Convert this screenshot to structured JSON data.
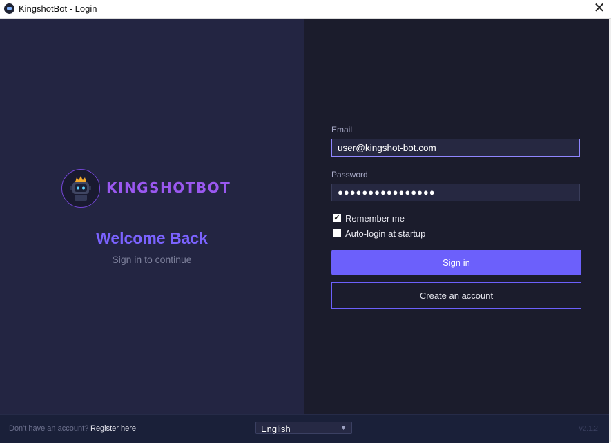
{
  "window": {
    "title": "KingshotBot - Login",
    "close_symbol": "✕"
  },
  "brand": {
    "name": "KINGSHOTBOT",
    "welcome": "Welcome Back",
    "subtitle": "Sign in to continue"
  },
  "form": {
    "email_label": "Email",
    "email_value": "user@kingshot-bot.com",
    "password_label": "Password",
    "password_value": "●●●●●●●●●●●●●●●●",
    "remember_label": "Remember me",
    "remember_checked": true,
    "autologin_label": "Auto-login at startup",
    "autologin_checked": false,
    "sign_in_label": "Sign in",
    "create_account_label": "Create an account"
  },
  "footer": {
    "no_account_text": "Don't have an account?",
    "register_label": "Register here",
    "language_selected": "English",
    "version": "v2.1.2"
  },
  "colors": {
    "accent": "#6c60fb",
    "left_bg": "#232542",
    "right_bg": "#1b1c2c",
    "brand": "#9a58f0",
    "crown": "#f2a92c"
  },
  "icons": {
    "app": "robot-logo-icon",
    "close": "close-icon",
    "check": "checkmark-icon",
    "dropdown": "chevron-down-icon"
  }
}
